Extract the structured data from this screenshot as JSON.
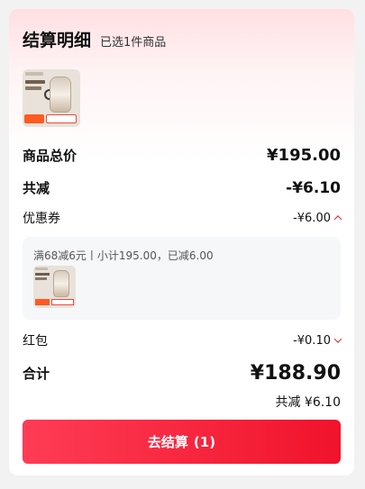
{
  "header": {
    "title": "结算明细",
    "subtitle": "已选1件商品"
  },
  "product": {
    "thumbnail": "product-thumbnail-baby-bottle"
  },
  "summary": {
    "total_label": "商品总价",
    "total_value": "¥195.00",
    "reduce_label": "共减",
    "reduce_value": "-¥6.10",
    "coupon_label": "优惠券",
    "coupon_value": "-¥6.00",
    "coupon_detail": "满68减6元丨小计195.00，已减6.00",
    "redpack_label": "红包",
    "redpack_value": "-¥0.10",
    "sum_label": "合计",
    "sum_value": "¥188.90",
    "saved_text": "共减 ¥6.10"
  },
  "checkout": {
    "label": "去结算",
    "count": "(1)"
  },
  "colors": {
    "accent_red": "#e02424",
    "button_gradient_start": "#ff3c55",
    "button_gradient_end": "#f0132b",
    "header_gradient": "#ffdfe2"
  }
}
